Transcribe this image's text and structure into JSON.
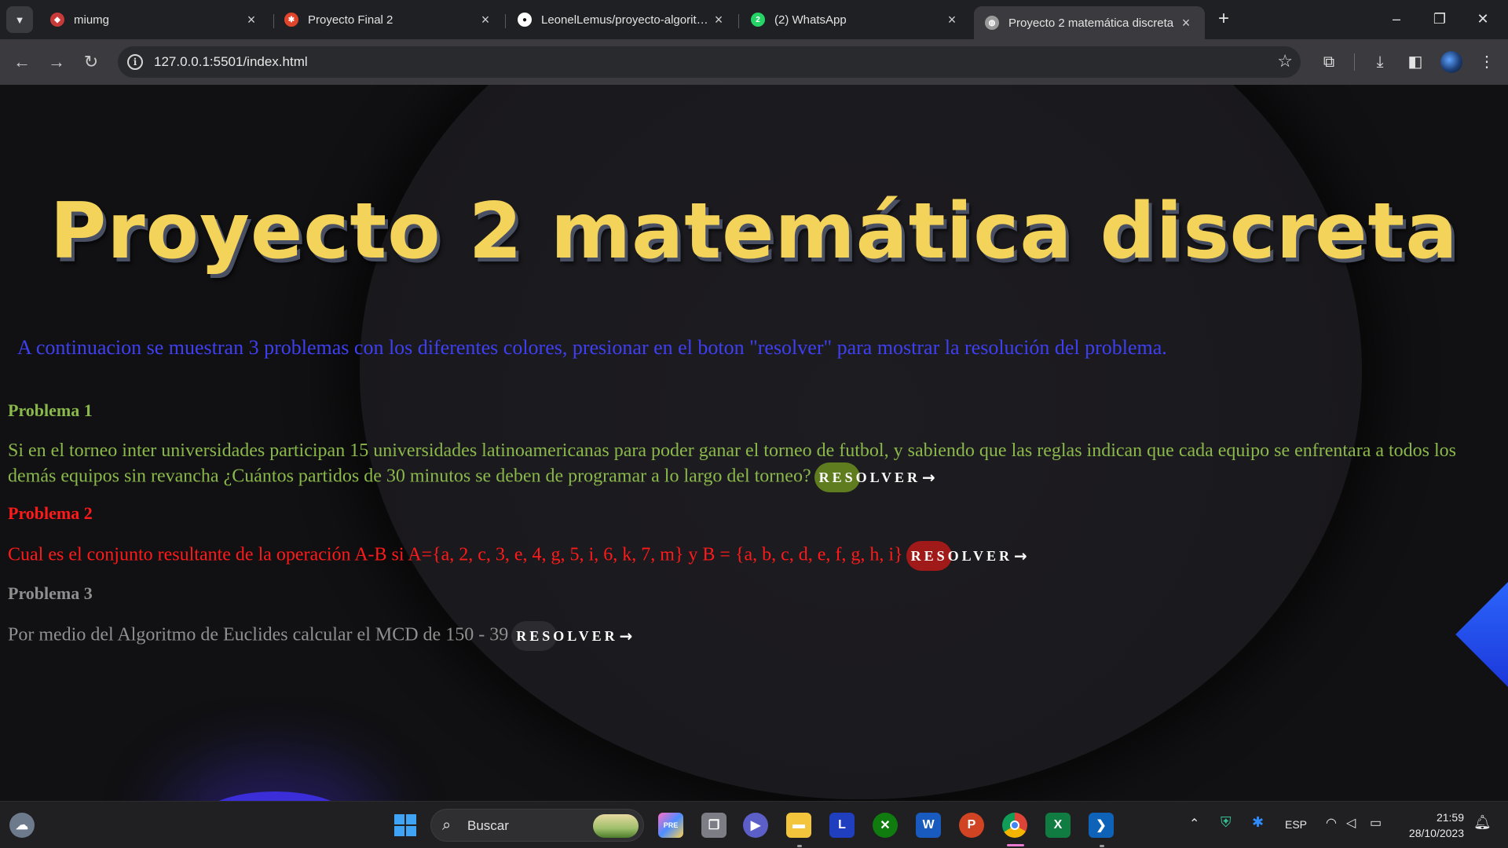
{
  "browser": {
    "tabs": [
      {
        "title": "miumg",
        "icon": "umg-icon",
        "color": "#c83a3a"
      },
      {
        "title": "Proyecto Final 2",
        "icon": "figma-like-icon",
        "color": "#e0452b"
      },
      {
        "title": "LeonelLemus/proyecto-algoritmos",
        "icon": "github-icon",
        "color": "#ffffff"
      },
      {
        "title": "(2) WhatsApp",
        "icon": "whatsapp-icon",
        "color": "#25d366"
      },
      {
        "title": "Proyecto 2 matemática discreta",
        "icon": "globe-icon",
        "color": "#9a9a9a"
      }
    ],
    "whatsapp_badge": "2",
    "url": "127.0.0.1:5501/index.html"
  },
  "page": {
    "title": "Proyecto 2 matemática discreta",
    "intro": "A continuacion se muestran 3 problemas con los diferentes colores, presionar en el boton \"resolver\" para mostrar la resolución del problema.",
    "problems": [
      {
        "heading": "Problema 1",
        "text": "Si en el torneo inter universidades participan 15 universidades latinoamericanas para poder ganar el torneo de futbol, y sabiendo que las reglas indican que cada equipo se enfrentara a todos los demás equipos sin revancha ¿Cuántos partidos de 30 minutos se deben de programar a lo largo del torneo?",
        "button": "RESOLVER",
        "color": "#8ab84a"
      },
      {
        "heading": "Problema 2",
        "text": "Cual es el conjunto resultante de la operación A-B si A={a, 2, c, 3, e, 4, g, 5, i, 6, k, 7, m} y B = {a, b, c, d, e, f, g, h, i}",
        "button": "RESOLVER",
        "color": "#ff1a1a"
      },
      {
        "heading": "Problema 3",
        "text": "Por medio del Algoritmo de Euclides calcular el MCD de 150 - 39",
        "button": "RESOLVER",
        "color": "#8f8f8f"
      }
    ],
    "arrow": "→"
  },
  "taskbar": {
    "search_label": "Buscar",
    "pre_badge": "PRE",
    "language": "ESP",
    "time": "21:59",
    "date": "28/10/2023",
    "launcher_letter": "L",
    "word_letter": "W",
    "powerpoint_letter": "P",
    "excel_letter": "X"
  }
}
